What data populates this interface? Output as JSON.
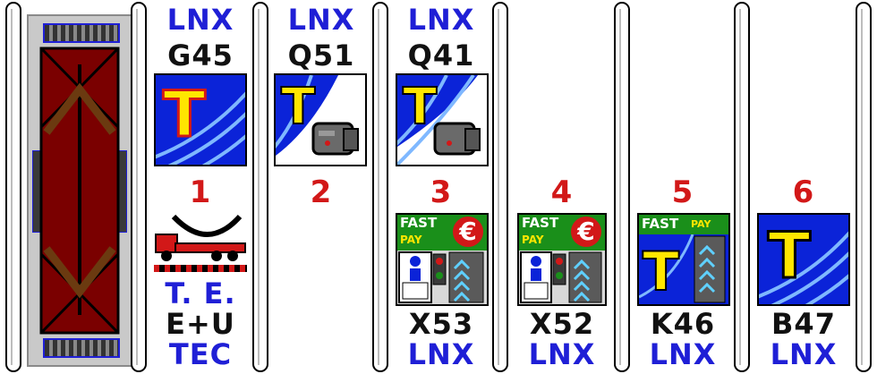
{
  "lanes": [
    {
      "id": 1,
      "top_code": "LNX",
      "icon_code": "G45",
      "number": "1",
      "bottom": [
        "T. E.",
        "E+U",
        "TEC"
      ]
    },
    {
      "id": 2,
      "top_code": "LNX",
      "icon_code": "Q51",
      "number": "2"
    },
    {
      "id": 3,
      "top_code": "LNX",
      "icon_code": "Q41",
      "number": "3",
      "bottom": [
        "X53",
        "LNX"
      ]
    },
    {
      "id": 4,
      "number": "4",
      "bottom": [
        "X52",
        "LNX"
      ]
    },
    {
      "id": 5,
      "number": "5",
      "bottom": [
        "K46",
        "LNX"
      ]
    },
    {
      "id": 6,
      "number": "6",
      "bottom": [
        "B47",
        "LNX"
      ]
    }
  ],
  "tiles": {
    "fastpay_top": "FAST",
    "fastpay_bottom": "PAY",
    "euro_symbol": "€",
    "tollpass_symbol": "T"
  },
  "icons": {
    "vehicle_icon": "crane-truck-icon",
    "toll_icon": "telepass-t-icon",
    "camera_icon": "camera-icon",
    "person_icon": "person-icon",
    "traffic_light_icon": "traffic-light-icon",
    "direction_icon": "chevron-up-icon",
    "bidirectional_icon": "double-arrow-icon"
  },
  "colors": {
    "accent_blue": "#1f1fd6",
    "number_red": "#d21818",
    "bridge_red": "#7a0000",
    "fastpay_green": "#1a8f1a",
    "tile_blue": "#0b23d8"
  }
}
